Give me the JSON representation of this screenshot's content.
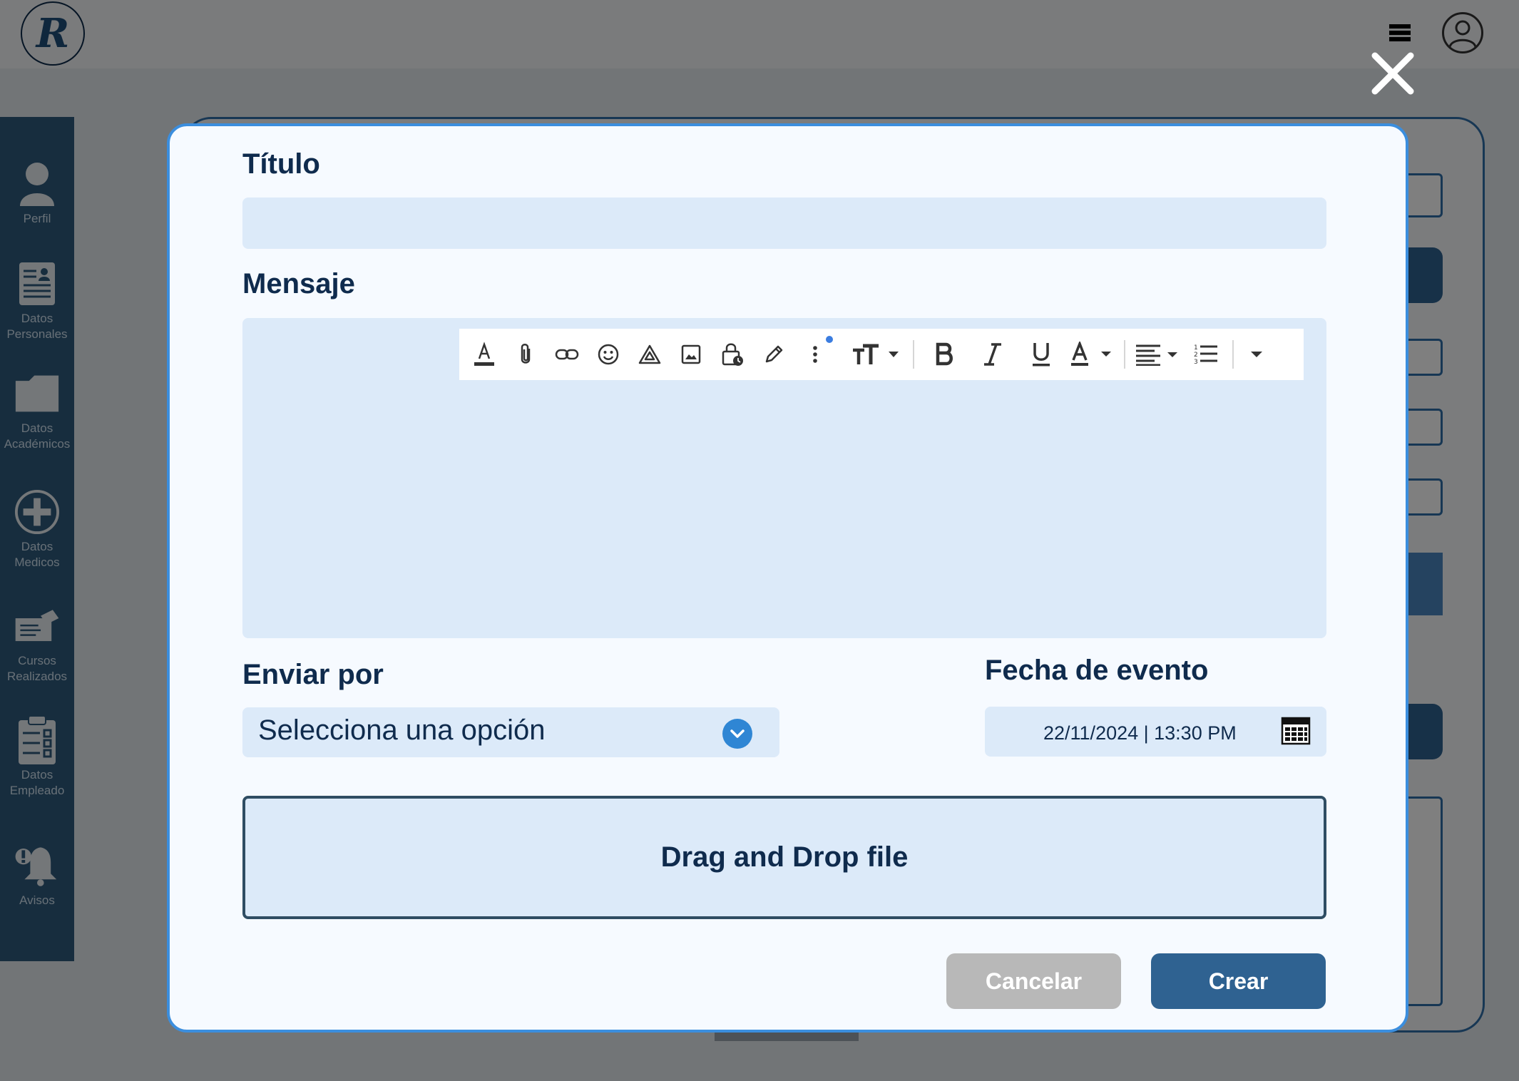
{
  "app": {
    "logo_letter": "R"
  },
  "sidebar": {
    "items": [
      {
        "label": "Perfil",
        "icon": "person-icon"
      },
      {
        "label": "Datos\nPersonales",
        "icon": "id-card-icon"
      },
      {
        "label": "Datos\nAcadémicos",
        "icon": "folder-icon"
      },
      {
        "label": "Datos\nMedicos",
        "icon": "plus-circle-icon"
      },
      {
        "label": "Cursos\nRealizados",
        "icon": "certificate-icon"
      },
      {
        "label": "Datos\nEmpleado",
        "icon": "clipboard-icon"
      },
      {
        "label": "Avisos",
        "icon": "bell-alert-icon"
      }
    ]
  },
  "modal": {
    "title_label": "Título",
    "title_value": "",
    "message_label": "Mensaje",
    "message_value": "",
    "toolbar": [
      "text-color-icon",
      "attach-icon",
      "link-icon",
      "emoji-icon",
      "drive-icon",
      "image-icon",
      "lock-clock-icon",
      "pen-icon",
      "more-options-icon",
      "font-size-icon",
      "bold-icon",
      "italic-icon",
      "underline-icon",
      "font-color-icon",
      "align-icon",
      "numbered-list-icon",
      "more-dropdown-icon"
    ],
    "send_by_label": "Enviar por",
    "send_by_value": "Selecciona una opción",
    "event_date_label": "Fecha de evento",
    "event_date_value": "22/11/2024 | 13:30 PM",
    "dropzone_text": "Drag and Drop file",
    "cancel_label": "Cancelar",
    "create_label": "Crear"
  },
  "colors": {
    "primary": "#2f6291",
    "modal_border": "#3b8ede",
    "input_bg": "#dceaf9",
    "text_dark": "#0f2b4d",
    "cancel_gray": "#b8b8b8"
  }
}
